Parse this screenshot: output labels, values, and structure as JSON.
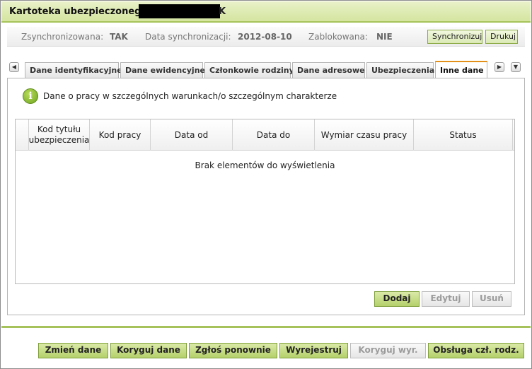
{
  "header": {
    "title": "Kartoteka ubezpieczonego -",
    "title_tail": "K"
  },
  "sync": {
    "synced_label": "Zsynchronizowana:",
    "synced_value": "TAK",
    "date_label": "Data synchronizacji:",
    "date_value": "2012-08-10",
    "locked_label": "Zablokowana:",
    "locked_value": "NIE",
    "sync_button": "Synchronizuj",
    "print_button": "Drukuj"
  },
  "tabs": [
    {
      "label": "Dane identyfikacyjne"
    },
    {
      "label": "Dane ewidencyjne"
    },
    {
      "label": "Członkowie rodziny"
    },
    {
      "label": "Dane adresowe"
    },
    {
      "label": "Ubezpieczenia"
    },
    {
      "label": "Inne dane",
      "active": true
    }
  ],
  "section": {
    "title": "Dane o pracy w szczególnych warunkach/o szczególnym charakterze"
  },
  "grid": {
    "columns": [
      "Kod tytułu ubezpieczenia",
      "Kod pracy",
      "Data od",
      "Data do",
      "Wymiar czasu pracy",
      "Status"
    ],
    "empty_message": "Brak elementów do wyświetlenia",
    "buttons": {
      "add": "Dodaj",
      "edit": "Edytuj",
      "delete": "Usuń"
    }
  },
  "footer": {
    "buttons": {
      "change": "Zmień dane",
      "correct": "Koryguj dane",
      "resubmit": "Zgłoś ponownie",
      "deregister": "Wyrejestruj",
      "correct_dereg": "Koryguj wyr.",
      "family": "Obsługa czł. rodz."
    }
  },
  "colors": {
    "accent_green": "#a5c35a",
    "active_tab": "#e3901a"
  }
}
